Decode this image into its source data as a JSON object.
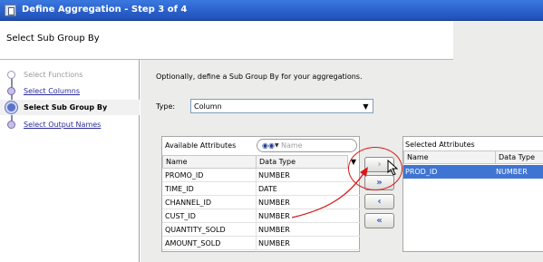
{
  "window": {
    "title": "Define Aggregation - Step 3 of 4"
  },
  "header": {
    "title": "Select Sub Group By"
  },
  "steps": [
    {
      "label": "Select Functions",
      "state": "done"
    },
    {
      "label": "Select Columns",
      "state": "link"
    },
    {
      "label": "Select Sub Group By",
      "state": "current"
    },
    {
      "label": "Select Output Names",
      "state": "link"
    }
  ],
  "instructions": "Optionally, define a Sub Group By for your aggregations.",
  "type": {
    "label": "Type:",
    "value": "Column"
  },
  "available": {
    "title": "Available Attributes",
    "search_placeholder": "Name",
    "columns": [
      "Name",
      "Data Type"
    ],
    "rows": [
      {
        "name": "PROMO_ID",
        "type": "NUMBER"
      },
      {
        "name": "TIME_ID",
        "type": "DATE"
      },
      {
        "name": "CHANNEL_ID",
        "type": "NUMBER"
      },
      {
        "name": "CUST_ID",
        "type": "NUMBER"
      },
      {
        "name": "QUANTITY_SOLD",
        "type": "NUMBER"
      },
      {
        "name": "AMOUNT_SOLD",
        "type": "NUMBER"
      }
    ]
  },
  "selected": {
    "title": "Selected Attributes",
    "columns": [
      "Name",
      "Data Type"
    ],
    "rows": [
      {
        "name": "PROD_ID",
        "type": "NUMBER"
      }
    ]
  },
  "move_buttons": [
    {
      "name": "move-selected-button",
      "glyph": "›",
      "enabled": false
    },
    {
      "name": "move-all-button",
      "glyph": "»",
      "enabled": true
    },
    {
      "name": "remove-selected-button",
      "glyph": "‹",
      "enabled": true
    },
    {
      "name": "remove-all-button",
      "glyph": "«",
      "enabled": true
    }
  ],
  "colors": {
    "title_bar": "#2a5fce",
    "selection": "#3f74d2",
    "annotation": "#d81818"
  }
}
